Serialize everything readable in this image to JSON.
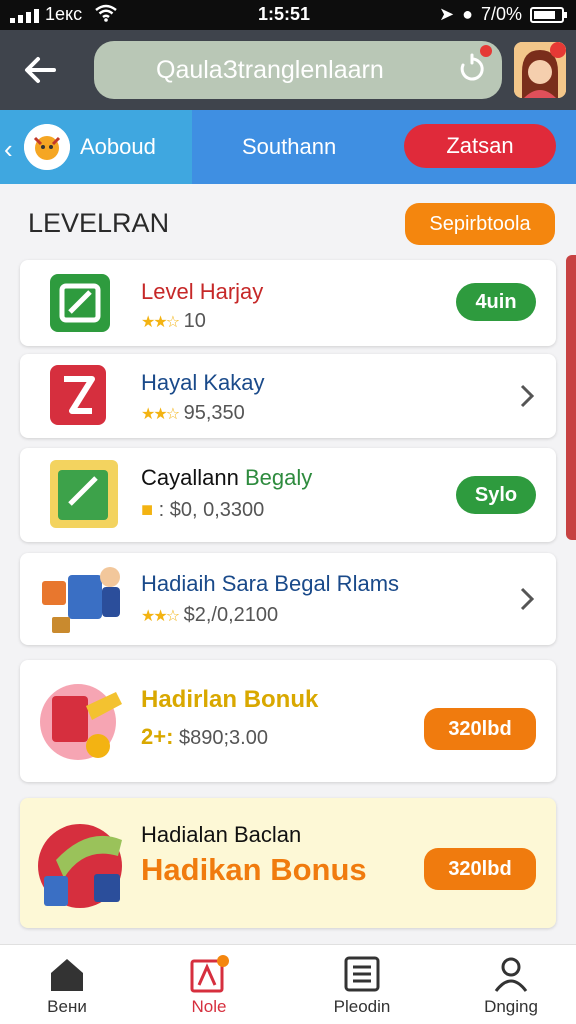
{
  "status": {
    "carrier": "1eкс",
    "time": "1:5:51",
    "battery": "7/0%"
  },
  "header": {
    "search_text": "QaulaЗtranglenlaarn"
  },
  "tabs": [
    {
      "label": "Aoboud"
    },
    {
      "label": "Southann"
    },
    {
      "label": "Zatsan"
    }
  ],
  "section": {
    "title": "LEVELRAN",
    "button_label": "Sepirbtoola"
  },
  "cards": [
    {
      "title": "Level Harjay",
      "subtitle": "10",
      "action": "4uin",
      "title_color": "#c62828"
    },
    {
      "title": "Hayal Kakay",
      "subtitle": "95,350",
      "title_color": "#1a4a8a"
    },
    {
      "title_a": "Cayallann ",
      "title_b": "Begaly",
      "subtitle": "$0, 0,3300",
      "action": "Sylo"
    },
    {
      "title": "Hadiaih Sara Begal Rlams",
      "subtitle": "$2,/0,2100"
    },
    {
      "title": "Hadirlan Bonuk",
      "prefix": "2+:",
      "subtitle": "$890;3.00",
      "action": "320lbd"
    },
    {
      "title": "Hadialan Baclan",
      "subtitle": "Hadikan Bonus",
      "action": "320lbd"
    }
  ],
  "nav": [
    {
      "label": "Beни"
    },
    {
      "label": "Nole"
    },
    {
      "label": "Pleodin"
    },
    {
      "label": "Dnging"
    }
  ],
  "colors": {
    "header": "#3f444c",
    "tab_active": "#e02a3a",
    "accent_orange": "#f4860e",
    "pill_green": "#2e9b3e"
  }
}
